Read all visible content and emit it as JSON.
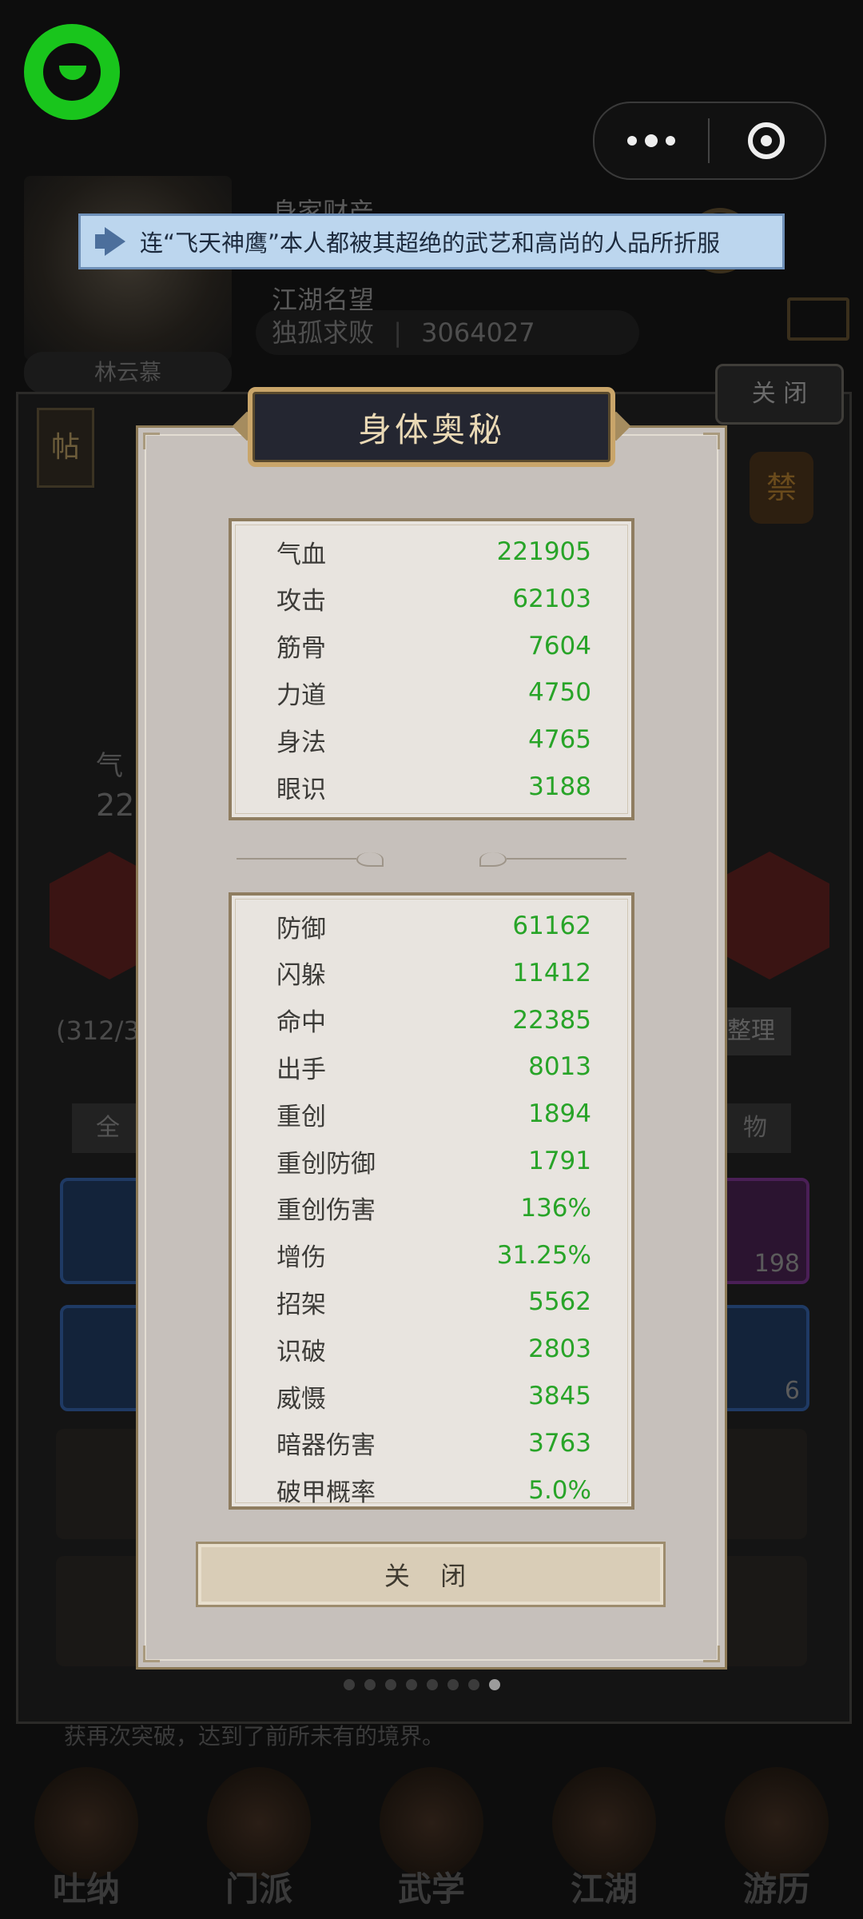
{
  "background": {
    "profile": {
      "line1": "身家财产",
      "line2": "江湖名望",
      "power_label": "独孤求败",
      "power_value": "3064027",
      "name": "林云慕"
    },
    "top_close_label": "关 闭",
    "tie_label": "帖",
    "ban_label": "禁",
    "hp_prefix": "气",
    "hp_value_prefix": "22",
    "bag_count": "(312/31",
    "sort_label": "整理",
    "tab_all": "全",
    "tab_item": "物",
    "slot_count_1": "198",
    "slot_count_2": "6",
    "footer_text": "获再次突破，达到了前所未有的境界。",
    "pager_active_index": 7,
    "nav": [
      "吐纳",
      "门派",
      "武学",
      "江湖",
      "游历"
    ]
  },
  "announcement": {
    "icon": "megaphone-icon",
    "text": "连“飞天神鹰”本人都被其超绝的武艺和高尚的人品所折服"
  },
  "modal": {
    "title": "身体奥秘",
    "primary_stats": [
      {
        "label": "气血",
        "value": "221905"
      },
      {
        "label": "攻击",
        "value": "62103"
      },
      {
        "label": "筋骨",
        "value": "7604"
      },
      {
        "label": "力道",
        "value": "4750"
      },
      {
        "label": "身法",
        "value": "4765"
      },
      {
        "label": "眼识",
        "value": "3188"
      }
    ],
    "secondary_stats": [
      {
        "label": "防御",
        "value": "61162"
      },
      {
        "label": "闪躲",
        "value": "11412"
      },
      {
        "label": "命中",
        "value": "22385"
      },
      {
        "label": "出手",
        "value": "8013"
      },
      {
        "label": "重创",
        "value": "1894"
      },
      {
        "label": "重创防御",
        "value": "1791"
      },
      {
        "label": "重创伤害",
        "value": "136%"
      },
      {
        "label": "增伤",
        "value": "31.25%"
      },
      {
        "label": "招架",
        "value": "5562"
      },
      {
        "label": "识破",
        "value": "2803"
      },
      {
        "label": "威慑",
        "value": "3845"
      },
      {
        "label": "暗器伤害",
        "value": "3763"
      },
      {
        "label": "破甲概率",
        "value": "5.0%"
      }
    ],
    "close_label": "关 闭"
  },
  "colors": {
    "stat_value": "#28a428",
    "modal_bg": "#c6c0bb",
    "title_plate": "#242631",
    "banner_bg": "#bcd6ee",
    "app_logo": "#19c51c"
  }
}
